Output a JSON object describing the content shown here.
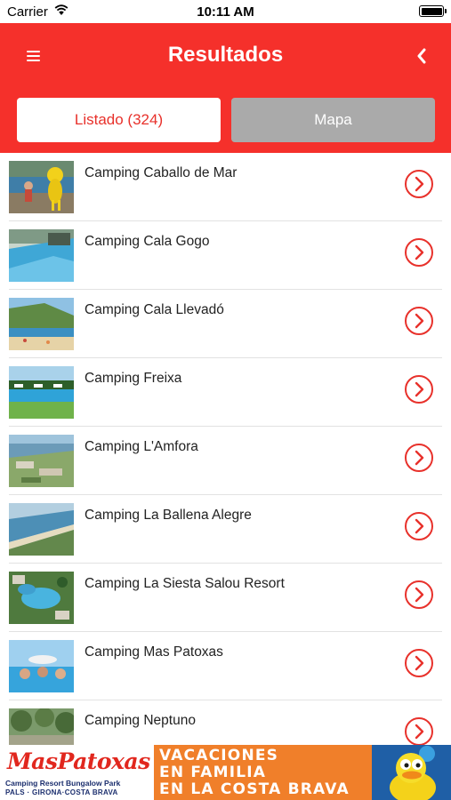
{
  "status_bar": {
    "carrier": "Carrier",
    "time": "10:11 AM",
    "icons": [
      "wifi-icon",
      "battery-icon"
    ]
  },
  "header": {
    "title": "Resultados",
    "menu_icon": "hamburger-menu-icon",
    "back_icon": "chevron-left-icon",
    "background_color": "#f5302b"
  },
  "tabs": [
    {
      "label": "Listado (324)",
      "selected": true
    },
    {
      "label": "Mapa",
      "selected": false
    }
  ],
  "results": [
    {
      "name": "Camping Caballo de Mar",
      "thumbnail": "mascot-at-pool-photo"
    },
    {
      "name": "Camping Cala Gogo",
      "thumbnail": "swimming-pool-photo"
    },
    {
      "name": "Camping Cala Llevadó",
      "thumbnail": "beach-cove-photo"
    },
    {
      "name": "Camping Freixa",
      "thumbnail": "pool-and-lawn-photo"
    },
    {
      "name": "Camping L'Amfora",
      "thumbnail": "aerial-campsite-photo"
    },
    {
      "name": "Camping La Ballena Alegre",
      "thumbnail": "aerial-coastline-photo"
    },
    {
      "name": "Camping La Siesta Salou Resort",
      "thumbnail": "resort-pool-photo"
    },
    {
      "name": "Camping Mas Patoxas",
      "thumbnail": "family-pool-photo"
    },
    {
      "name": "Camping Neptuno",
      "thumbnail": "trees-photo"
    }
  ],
  "row_action_icon": "chevron-right-circle-icon",
  "accent_color": "#e8312b",
  "ad_banner": {
    "brand": "MasPatoxas",
    "subtitle": "Camping Resort Bungalow Park",
    "location": "PALS · GIRONA·COSTA BRAVA",
    "slogan_lines": [
      "VACACIONES",
      "EN FAMILIA",
      "EN LA COSTA BRAVA"
    ],
    "mascot": "duck-mascot-image",
    "colors": {
      "brand": "#e1271e",
      "slogan_bg": "#f07f2a",
      "mascot_bg": "#1f5fa6"
    }
  }
}
